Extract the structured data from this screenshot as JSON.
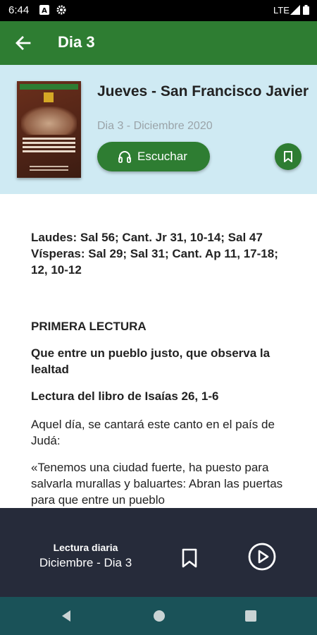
{
  "status_bar": {
    "time": "6:44",
    "network": "LTE"
  },
  "app_bar": {
    "title": "Dia 3"
  },
  "header": {
    "title": "Jueves - San Francisco Javier",
    "subtitle": "Dia 3 - Diciembre 2020",
    "listen_label": "Escuchar"
  },
  "content": {
    "psalms": "Laudes: Sal 56; Cant. Jr 31, 10-14; Sal 47 Vísperas: Sal 29; Sal 31; Cant. Ap 11, 17-18; 12, 10-12",
    "section": "PRIMERA LECTURA",
    "reading_title": "Que entre un pueblo justo, que observa la lealtad",
    "reading_source": "Lectura del libro de Isaías 26, 1-6",
    "para1": "Aquel día, se cantará este canto en el país de Judá:",
    "para2": "«Tenemos una ciudad fuerte, ha puesto para salvarla murallas y baluartes: Abran las puertas para que entre un pueblo"
  },
  "player": {
    "line1": "Lectura diaria",
    "line2": "Diciembre - Dia 3"
  },
  "colors": {
    "primary": "#2e7d32",
    "header_bg": "#cfeaf3",
    "player_bg": "#262b3a",
    "nav_bg": "#1a5258"
  },
  "icons": [
    "notification-a-icon",
    "settings-gear-icon",
    "signal-icon",
    "battery-icon",
    "back-arrow-icon",
    "headphones-icon",
    "bookmark-icon",
    "play-circle-icon",
    "nav-back-icon",
    "nav-home-icon",
    "nav-recents-icon"
  ]
}
